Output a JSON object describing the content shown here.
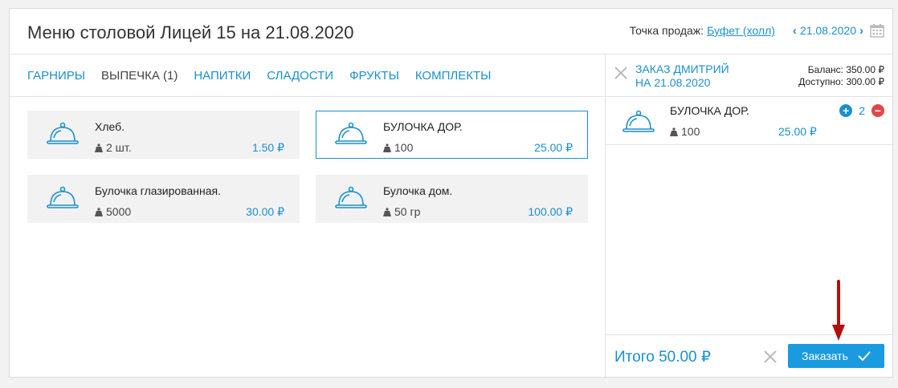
{
  "header": {
    "title": "Меню столовой Лицей 15 на 21.08.2020",
    "point_of_sale_label": "Точка продаж:",
    "point_of_sale_value": "Буфет (холл)",
    "date": "21.08.2020",
    "prev_icon": "chevron-left-icon",
    "next_icon": "chevron-right-icon",
    "calendar_icon": "calendar-icon"
  },
  "tabs": [
    {
      "label": "ГАРНИРЫ",
      "active": false
    },
    {
      "label": "ВЫПЕЧКА (1)",
      "active": true
    },
    {
      "label": "НАПИТКИ",
      "active": false
    },
    {
      "label": "СЛАДОСТИ",
      "active": false
    },
    {
      "label": "ФРУКТЫ",
      "active": false
    },
    {
      "label": "КОМПЛЕКТЫ",
      "active": false
    }
  ],
  "menu_items": [
    {
      "name": "Хлеб.",
      "qty": "2 шт.",
      "price": "1.50 ₽",
      "selected": false
    },
    {
      "name": "БУЛОЧКА ДОР.",
      "qty": "100",
      "price": "25.00 ₽",
      "selected": true
    },
    {
      "name": "Булочка глазированная.",
      "qty": "5000",
      "price": "30.00 ₽",
      "selected": false
    },
    {
      "name": "Булочка дом.",
      "qty": "50 гр",
      "price": "100.00 ₽",
      "selected": false
    }
  ],
  "order": {
    "title_line1": "ЗАКАЗ ДМИТРИЙ",
    "title_line2": "НА 21.08.2020",
    "balance": "Баланс: 350.00 ₽",
    "available": "Доступно: 300.00 ₽",
    "items": [
      {
        "name": "БУЛОЧКА ДОР.",
        "qty": "100",
        "price": "25.00 ₽",
        "count": "2"
      }
    ],
    "total": "Итого 50.00 ₽",
    "submit_label": "Заказать"
  },
  "colors": {
    "accent": "#1a8fcf",
    "button": "#1a9be0",
    "minus": "#e04848",
    "annotation_arrow": "#b01010"
  }
}
